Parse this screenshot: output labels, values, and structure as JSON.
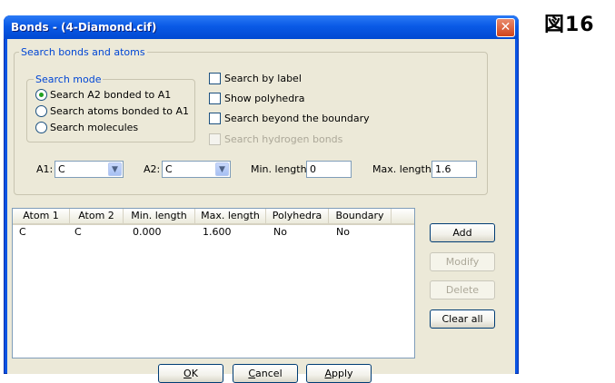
{
  "figure_label": "図16",
  "window": {
    "title": "Bonds - (4-Diamond.cif)",
    "close_glyph": "✕"
  },
  "search_group": {
    "label": "Search bonds and atoms",
    "mode_label": "Search mode",
    "modes": [
      {
        "label": "Search A2 bonded to A1",
        "selected": true
      },
      {
        "label": "Search atoms bonded to A1",
        "selected": false
      },
      {
        "label": "Search molecules",
        "selected": false
      }
    ],
    "options": [
      {
        "label": "Search by label",
        "checked": false,
        "enabled": true
      },
      {
        "label": "Show polyhedra",
        "checked": false,
        "enabled": true
      },
      {
        "label": "Search beyond the boundary",
        "checked": false,
        "enabled": true
      },
      {
        "label": "Search hydrogen bonds",
        "checked": false,
        "enabled": false
      }
    ],
    "a1_label": "A1:",
    "a1_value": "C",
    "a2_label": "A2:",
    "a2_value": "C",
    "min_label": "Min. length:",
    "min_value": "0",
    "max_label": "Max. length:",
    "max_value": "1.6"
  },
  "table": {
    "columns": [
      "Atom 1",
      "Atom 2",
      "Min. length",
      "Max. length",
      "Polyhedra",
      "Boundary"
    ],
    "rows": [
      [
        "C",
        "C",
        "0.000",
        "1.600",
        "No",
        "No"
      ]
    ]
  },
  "side_buttons": {
    "add": "Add",
    "modify": "Modify",
    "delete": "Delete",
    "clear_all": "Clear all"
  },
  "footer_buttons": {
    "ok_key": "O",
    "ok_rest": "K",
    "cancel_key": "C",
    "cancel_rest": "ancel",
    "apply_key": "A",
    "apply_rest": "pply"
  }
}
